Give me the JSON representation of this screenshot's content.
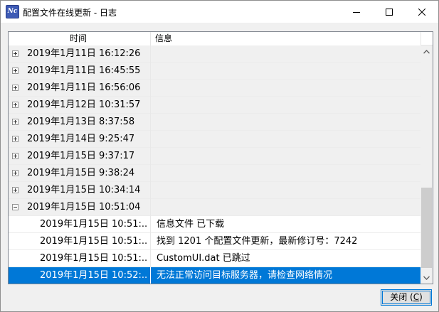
{
  "window": {
    "title": "配置文件在线更新 - 日志",
    "app_icon_text": "Nc"
  },
  "columns": {
    "time": "时间",
    "info": "信息"
  },
  "rows": [
    {
      "time": "2019年1月11日 16:12:26",
      "info": "",
      "kind": "group",
      "expanded": false
    },
    {
      "time": "2019年1月11日 16:45:55",
      "info": "",
      "kind": "group",
      "expanded": false
    },
    {
      "time": "2019年1月11日 16:56:06",
      "info": "",
      "kind": "group",
      "expanded": false
    },
    {
      "time": "2019年1月12日 10:31:57",
      "info": "",
      "kind": "group",
      "expanded": false
    },
    {
      "time": "2019年1月13日 8:37:58",
      "info": "",
      "kind": "group",
      "expanded": false
    },
    {
      "time": "2019年1月14日 9:25:47",
      "info": "",
      "kind": "group",
      "expanded": false
    },
    {
      "time": "2019年1月15日 9:37:17",
      "info": "",
      "kind": "group",
      "expanded": false
    },
    {
      "time": "2019年1月15日 9:38:24",
      "info": "",
      "kind": "group",
      "expanded": false
    },
    {
      "time": "2019年1月15日 10:34:14",
      "info": "",
      "kind": "group",
      "expanded": false
    },
    {
      "time": "2019年1月15日 10:51:04",
      "info": "",
      "kind": "group",
      "expanded": true
    },
    {
      "time": "2019年1月15日 10:51:...",
      "info": "信息文件 已下载",
      "kind": "child"
    },
    {
      "time": "2019年1月15日 10:51:...",
      "info": "找到 1201 个配置文件更新，最新修订号：7242",
      "kind": "child"
    },
    {
      "time": "2019年1月15日 10:51:...",
      "info": "CustomUI.dat 已跳过",
      "kind": "child"
    },
    {
      "time": "2019年1月15日 10:52:...",
      "info": "无法正常访问目标服务器，请检查网络情况",
      "kind": "child",
      "selected": true
    }
  ],
  "buttons": {
    "close_label": "关闭 (",
    "close_hotkey": "C",
    "close_suffix": ")"
  },
  "colors": {
    "selection": "#0078d7",
    "group_row_bg": "#f0f0f0",
    "window_bg": "#f0f0f0"
  },
  "icons": {
    "minimize": "minimize-icon",
    "maximize": "maximize-icon",
    "close": "close-icon",
    "expand": "plus-box-icon",
    "collapse": "minus-box-icon",
    "scroll_up": "chevron-up-icon",
    "scroll_down": "chevron-down-icon"
  }
}
